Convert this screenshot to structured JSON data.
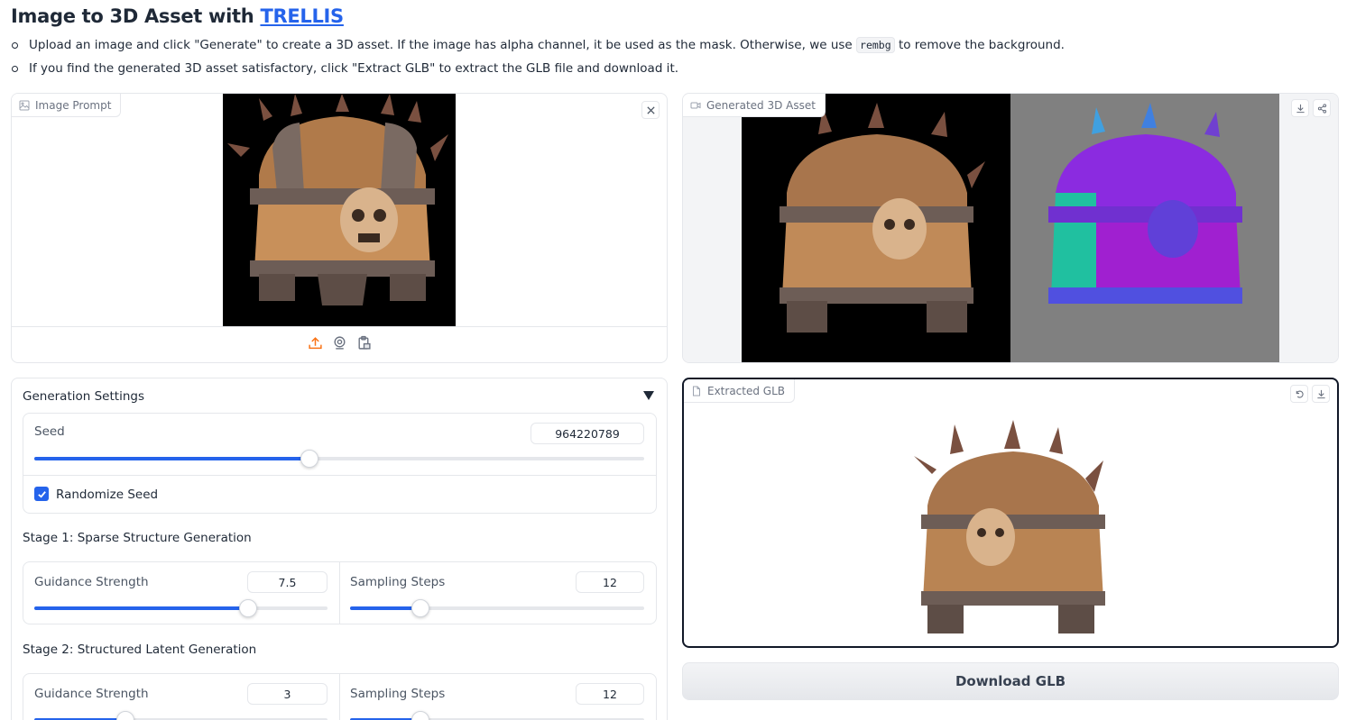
{
  "header": {
    "title_prefix": "Image to 3D Asset with ",
    "title_link": "TRELLIS"
  },
  "instructions": {
    "line1_before": "Upload an image and click \"Generate\" to create a 3D asset. If the image has alpha channel, it be used as the mask. Otherwise, we use ",
    "line1_code": "rembg",
    "line1_after": " to remove the background.",
    "line2": "If you find the generated 3D asset satisfactory, click \"Extract GLB\" to extract the GLB file and download it."
  },
  "image_prompt": {
    "label": "Image Prompt"
  },
  "generated": {
    "label": "Generated 3D Asset"
  },
  "extracted": {
    "label": "Extracted GLB"
  },
  "settings": {
    "title": "Generation Settings",
    "seed": {
      "label": "Seed",
      "value": "964220789",
      "fraction": 0.451
    },
    "randomize": {
      "label": "Randomize Seed",
      "checked": true
    },
    "stage1": {
      "title": "Stage 1: Sparse Structure Generation",
      "guidance": {
        "label": "Guidance Strength",
        "value": "7.5",
        "fraction": 0.73
      },
      "steps": {
        "label": "Sampling Steps",
        "value": "12",
        "fraction": 0.24
      }
    },
    "stage2": {
      "title": "Stage 2: Structured Latent Generation",
      "guidance": {
        "label": "Guidance Strength",
        "value": "3",
        "fraction": 0.31
      },
      "steps": {
        "label": "Sampling Steps",
        "value": "12",
        "fraction": 0.24
      }
    }
  },
  "download_button": "Download GLB",
  "colors": {
    "accent": "#2563eb",
    "border": "#e5e7eb",
    "upload_icon": "#f97316"
  }
}
